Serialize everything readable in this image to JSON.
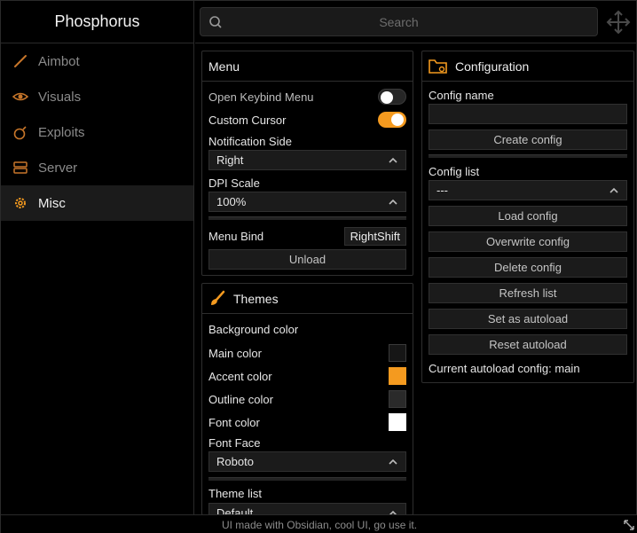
{
  "app": {
    "title": "Phosphorus"
  },
  "colors": {
    "accent": "#f49a1f",
    "main": "#161616",
    "outline": "#2a2a2a",
    "font": "#ffffff",
    "background": "#000000"
  },
  "sidebar": {
    "items": [
      {
        "label": "Aimbot",
        "icon": "knife-icon",
        "active": false
      },
      {
        "label": "Visuals",
        "icon": "eye-icon",
        "active": false
      },
      {
        "label": "Exploits",
        "icon": "bomb-icon",
        "active": false
      },
      {
        "label": "Server",
        "icon": "server-icon",
        "active": false
      },
      {
        "label": "Misc",
        "icon": "gear-icon",
        "active": true
      }
    ]
  },
  "search": {
    "placeholder": "Search",
    "value": ""
  },
  "menu_panel": {
    "title": "Menu",
    "open_keybind_label": "Open Keybind Menu",
    "open_keybind_on": false,
    "custom_cursor_label": "Custom Cursor",
    "custom_cursor_on": true,
    "notification_side_label": "Notification Side",
    "notification_side_value": "Right",
    "dpi_scale_label": "DPI Scale",
    "dpi_scale_value": "100%",
    "menu_bind_label": "Menu Bind",
    "menu_bind_value": "RightShift",
    "unload_label": "Unload"
  },
  "themes_panel": {
    "title": "Themes",
    "background_color_label": "Background color",
    "main_color_label": "Main color",
    "accent_color_label": "Accent color",
    "outline_color_label": "Outline color",
    "font_color_label": "Font color",
    "font_face_label": "Font Face",
    "font_face_value": "Roboto",
    "theme_list_label": "Theme list",
    "theme_list_value": "Default"
  },
  "config_panel": {
    "title": "Configuration",
    "config_name_label": "Config name",
    "config_name_value": "",
    "create_config_label": "Create config",
    "config_list_label": "Config list",
    "config_list_value": "---",
    "load_config_label": "Load config",
    "overwrite_config_label": "Overwrite config",
    "delete_config_label": "Delete config",
    "refresh_list_label": "Refresh list",
    "set_autoload_label": "Set as autoload",
    "reset_autoload_label": "Reset autoload",
    "current_autoload_label": "Current autoload config: main"
  },
  "footer": {
    "text": "UI made with Obsidian, cool UI, go use it."
  }
}
